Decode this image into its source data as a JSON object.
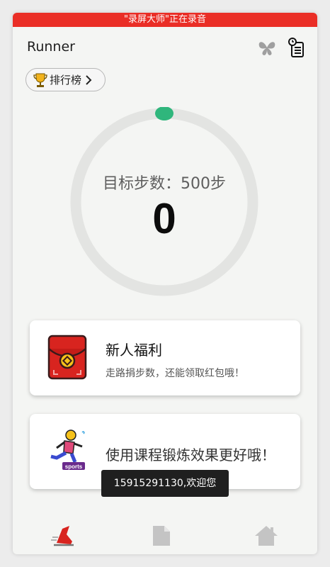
{
  "status_bar": {
    "recording_text": "\"录屏大师\"正在录音"
  },
  "header": {
    "title": "Runner",
    "icons": [
      "butterfly-icon",
      "history-record-icon"
    ]
  },
  "leaderboard": {
    "label": "排行榜",
    "icon": "trophy-icon"
  },
  "progress": {
    "goal_label": "目标步数：500步",
    "step_count": "0",
    "fraction": 0,
    "track_color": "#e3e4e2",
    "indicator_color": "#2fb67c"
  },
  "cards": [
    {
      "title": "新人福利",
      "subtitle": "走路捐步数，还能领取红包哦！",
      "icon": "red-envelope-icon"
    },
    {
      "title": "使用课程锻炼效果更好哦！",
      "icon": "sports-runner-icon"
    }
  ],
  "toast": {
    "text": "15915291130,欢迎您"
  },
  "bottom_nav": {
    "items": [
      {
        "name": "run",
        "icon": "running-shoe-icon",
        "active": true
      },
      {
        "name": "document",
        "icon": "document-icon",
        "active": false
      },
      {
        "name": "home",
        "icon": "home-icon",
        "active": false
      }
    ]
  },
  "colors": {
    "recording_bar": "#ea2e26",
    "background": "#f4f5f3",
    "accent_red": "#d8241f"
  }
}
